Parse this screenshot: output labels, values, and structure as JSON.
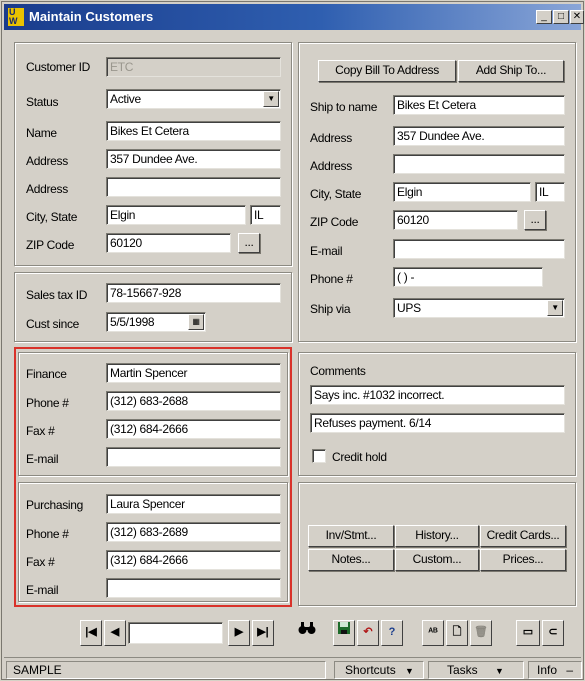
{
  "window": {
    "title": "Maintain Customers",
    "app_icon_text": "U W"
  },
  "customer": {
    "id_label": "Customer ID",
    "id_value": "ETC",
    "status_label": "Status",
    "status_value": "Active",
    "name_label": "Name",
    "name_value": "Bikes Et Cetera",
    "address_label": "Address",
    "address1_value": "357 Dundee Ave.",
    "address2_label": "Address",
    "address2_value": "",
    "city_state_label": "City, State",
    "city_value": "Elgin",
    "state_value": "IL",
    "zip_label": "ZIP Code",
    "zip_value": "60120",
    "zip_button": "..."
  },
  "tax": {
    "sales_tax_label": "Sales tax ID",
    "sales_tax_value": "78-15667-928",
    "cust_since_label": "Cust since",
    "cust_since_value": "5/5/1998"
  },
  "shipping": {
    "copy_bill_button": "Copy Bill To Address",
    "add_ship_button": "Add Ship To...",
    "ship_name_label": "Ship to name",
    "ship_name_value": "Bikes Et Cetera",
    "address_label": "Address",
    "address1_value": "357 Dundee Ave.",
    "address2_label": "Address",
    "address2_value": "",
    "city_state_label": "City, State",
    "city_value": "Elgin",
    "state_value": "IL",
    "zip_label": "ZIP Code",
    "zip_value": "60120",
    "zip_button": "...",
    "email_label": "E-mail",
    "email_value": "",
    "phone_label": "Phone #",
    "phone_value": "(   )   -",
    "ship_via_label": "Ship via",
    "ship_via_value": "UPS"
  },
  "finance": {
    "label": "Finance",
    "contact_value": "Martin Spencer",
    "phone_label": "Phone #",
    "phone_value": "(312) 683-2688",
    "fax_label": "Fax #",
    "fax_value": "(312) 684-2666",
    "email_label": "E-mail",
    "email_value": ""
  },
  "purchasing": {
    "label": "Purchasing",
    "contact_value": "Laura Spencer",
    "phone_label": "Phone #",
    "phone_value": "(312) 683-2689",
    "fax_label": "Fax #",
    "fax_value": "(312) 684-2666",
    "email_label": "E-mail",
    "email_value": ""
  },
  "comments": {
    "label": "Comments",
    "line1": "Says inc. #1032 incorrect.",
    "line2": "Refuses payment. 6/14",
    "credit_hold_label": "Credit hold",
    "credit_hold_checked": false
  },
  "actions": {
    "inv_stmt": "Inv/Stmt...",
    "history": "History...",
    "credit_cards": "Credit Cards...",
    "notes": "Notes...",
    "custom": "Custom...",
    "prices": "Prices..."
  },
  "toolbar": {
    "first": "|◀",
    "prev": "◀",
    "next": "▶",
    "last": "▶|",
    "record_value": ""
  },
  "status_bar": {
    "company": "SAMPLE",
    "shortcuts": "Shortcuts",
    "tasks": "Tasks",
    "info": "Info"
  },
  "colors": {
    "highlight_frame": "#d9322a",
    "title_bar": "#1a3c8c"
  }
}
